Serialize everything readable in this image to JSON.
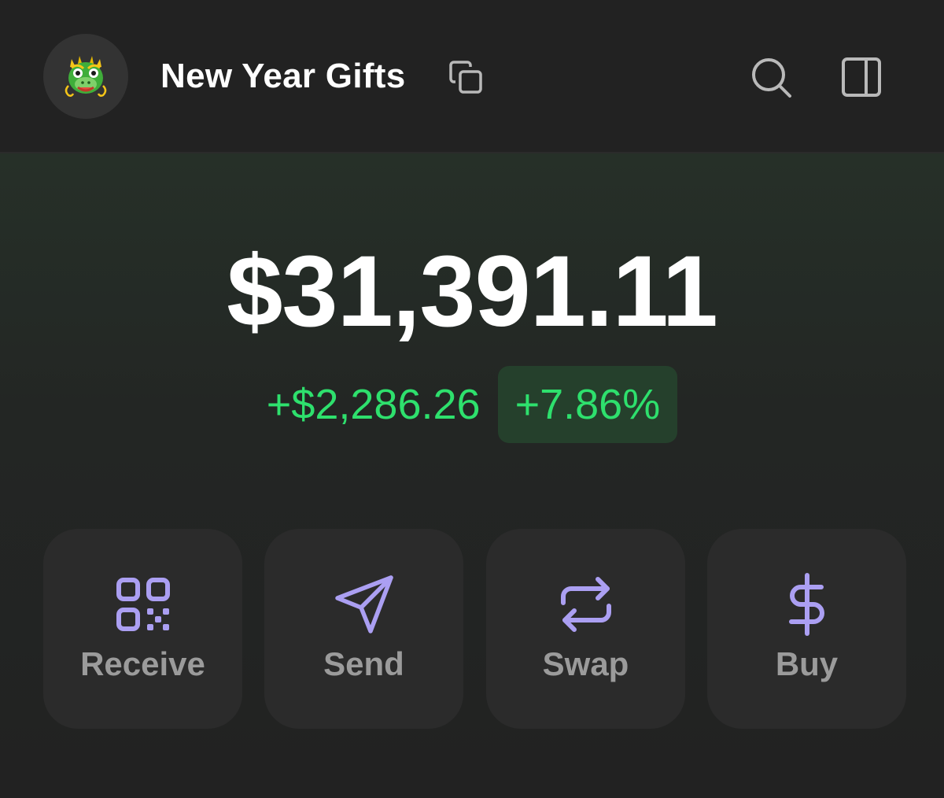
{
  "header": {
    "wallet_name": "New Year Gifts",
    "avatar_icon": "dragon-face-emoji",
    "copy_icon": "copy-icon",
    "search_icon": "search-icon",
    "panel_icon": "side-panel-icon"
  },
  "portfolio": {
    "balance": "$31,391.11",
    "change_amount": "+$2,286.26",
    "change_percent": "+7.86%"
  },
  "actions": [
    {
      "label": "Receive",
      "icon": "qr-code-icon"
    },
    {
      "label": "Send",
      "icon": "send-icon"
    },
    {
      "label": "Swap",
      "icon": "swap-arrows-icon"
    },
    {
      "label": "Buy",
      "icon": "dollar-icon"
    }
  ],
  "colors": {
    "background": "#222222",
    "card": "#2b2b2b",
    "accent_purple": "#ab9ff2",
    "positive_green": "#2ee06d",
    "positive_bg": "#25402c"
  }
}
